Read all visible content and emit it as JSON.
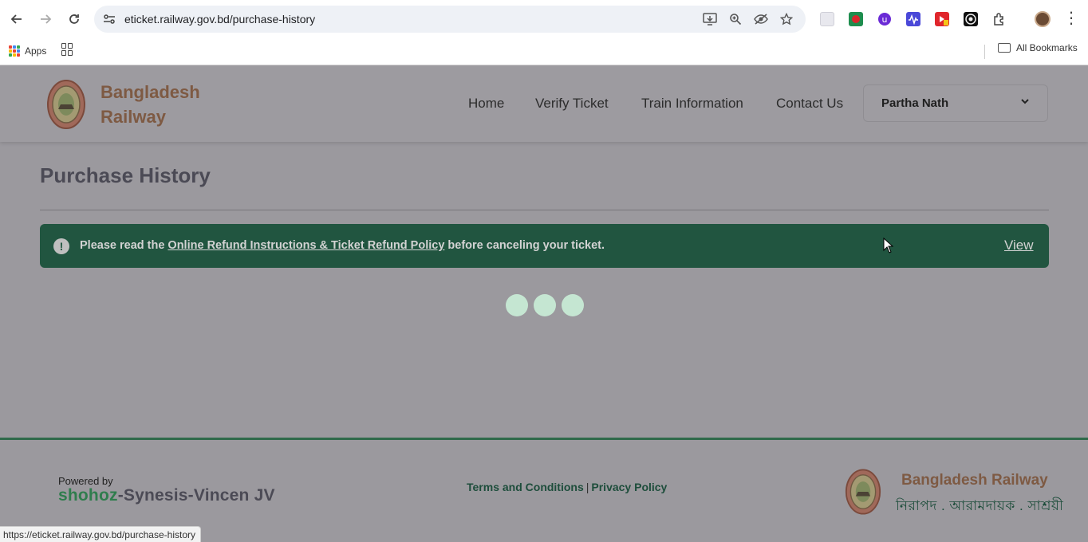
{
  "browser": {
    "url": "eticket.railway.gov.bd/purchase-history",
    "bookmarks": {
      "apps_label": "Apps",
      "all_bookmarks_label": "All Bookmarks"
    },
    "status_url": "https://eticket.railway.gov.bd/purchase-history"
  },
  "header": {
    "brand_line1": "Bangladesh",
    "brand_line2": "Railway",
    "nav": [
      "Home",
      "Verify Ticket",
      "Train Information",
      "Contact Us"
    ],
    "user_name": "Partha Nath"
  },
  "main": {
    "title": "Purchase History",
    "alert": {
      "prefix": "Please read the ",
      "link": "Online Refund Instructions & Ticket Refund Policy",
      "suffix": " before canceling your ticket.",
      "view_label": "View",
      "icon": "!"
    }
  },
  "footer": {
    "powered_by": "Powered by",
    "jv_part1": "shohoz",
    "jv_part2": "-Synesis-Vincen JV",
    "terms": "Terms and Conditions",
    "separator": "|",
    "privacy": "Privacy Policy",
    "brand": "Bangladesh Railway",
    "tagline": "নিরাপদ . আরামদায়ক . সাশ্রয়ী"
  },
  "colors": {
    "alert_bg": "#215540",
    "brand_brown": "#7e5a43",
    "footer_green": "#2f6a4a",
    "loader_dot": "#c5e6d2"
  },
  "icons": [
    "back-icon",
    "forward-icon",
    "reload-icon",
    "site-settings-icon",
    "install-icon",
    "zoom-icon",
    "eye-off-icon",
    "star-icon",
    "extensions-icon",
    "kebab-menu-icon",
    "apps-icon",
    "tab-groups-icon",
    "folder-icon",
    "chevron-down-icon",
    "exclamation-icon",
    "cursor-icon"
  ]
}
